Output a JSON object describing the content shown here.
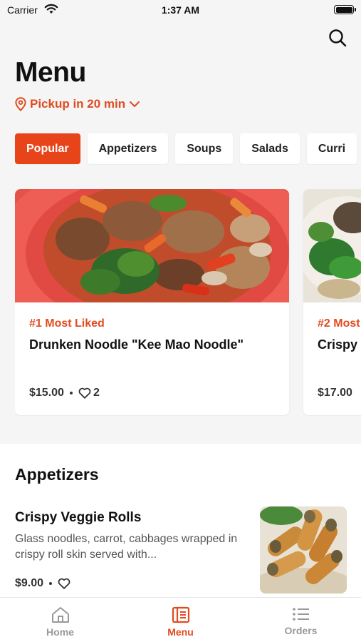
{
  "status_bar": {
    "carrier": "Carrier",
    "time": "1:37 AM"
  },
  "header": {
    "title": "Menu",
    "pickup_label": "Pickup in 20 min"
  },
  "tabs": [
    {
      "label": "Popular",
      "active": true
    },
    {
      "label": "Appetizers"
    },
    {
      "label": "Soups"
    },
    {
      "label": "Salads"
    },
    {
      "label": "Curri"
    }
  ],
  "popular_cards": [
    {
      "rank": "#1 Most Liked",
      "name": "Drunken Noodle \"Kee Mao Noodle\"",
      "price": "$15.00",
      "likes": "2"
    },
    {
      "rank": "#2 Most",
      "name": "Crispy",
      "price": "$17.00"
    }
  ],
  "appetizers": {
    "title": "Appetizers",
    "items": [
      {
        "name": "Crispy Veggie Rolls",
        "description": "Glass noodles, carrot, cabbages wrapped in crispy roll skin served with...",
        "price": "$9.00"
      }
    ]
  },
  "bottom_nav": [
    {
      "label": "Home",
      "icon": "home-icon"
    },
    {
      "label": "Menu",
      "icon": "menu-book-icon",
      "active": true
    },
    {
      "label": "Orders",
      "icon": "list-icon"
    }
  ],
  "colors": {
    "accent": "#e84419",
    "accent_text": "#e14b1f",
    "background": "#f5f5f5"
  }
}
